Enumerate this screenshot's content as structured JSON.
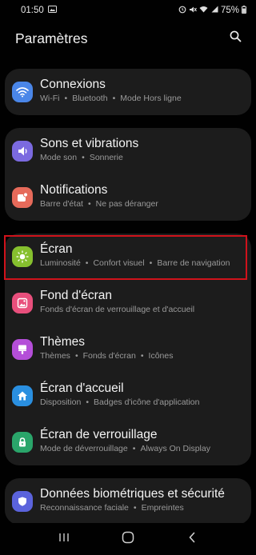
{
  "status_bar": {
    "time": "01:50",
    "battery": "75%",
    "icons": [
      "image-icon",
      "alarm-icon",
      "mute-icon",
      "wifi-icon",
      "signal-icon",
      "battery-icon"
    ]
  },
  "header": {
    "title": "Paramètres",
    "search_icon": "search-icon"
  },
  "groups": [
    {
      "items": [
        {
          "title": "Connexions",
          "subtitle": [
            "Wi-Fi",
            "Bluetooth",
            "Mode Hors ligne"
          ],
          "icon": "wifi-icon",
          "color": "#4a86e8"
        }
      ]
    },
    {
      "items": [
        {
          "title": "Sons et vibrations",
          "subtitle": [
            "Mode son",
            "Sonnerie"
          ],
          "icon": "volume-icon",
          "color": "#7b6ae0"
        },
        {
          "title": "Notifications",
          "subtitle": [
            "Barre d'état",
            "Ne pas déranger"
          ],
          "icon": "notification-icon",
          "color": "#e66a5a"
        }
      ]
    },
    {
      "items": [
        {
          "title": "Écran",
          "subtitle": [
            "Luminosité",
            "Confort visuel",
            "Barre de navigation"
          ],
          "icon": "brightness-icon",
          "color": "#86c02e",
          "highlighted": true
        },
        {
          "title": "Fond d'écran",
          "subtitle": [
            "Fonds d'écran de verrouillage et d'accueil"
          ],
          "icon": "wallpaper-icon",
          "color": "#e84f7c"
        },
        {
          "title": "Thèmes",
          "subtitle": [
            "Thèmes",
            "Fonds d'écran",
            "Icônes"
          ],
          "icon": "theme-brush-icon",
          "color": "#b44ed8"
        },
        {
          "title": "Écran d'accueil",
          "subtitle": [
            "Disposition",
            "Badges d'icône d'application"
          ],
          "icon": "home-icon",
          "color": "#2a8fe0"
        },
        {
          "title": "Écran de verrouillage",
          "subtitle": [
            "Mode de déverrouillage",
            "Always On Display"
          ],
          "icon": "lock-icon",
          "color": "#2aa56a"
        }
      ]
    },
    {
      "items": [
        {
          "title": "Données biométriques et sécurité",
          "subtitle": [
            "Reconnaissance faciale",
            "Empreintes"
          ],
          "icon": "shield-icon",
          "color": "#5b63dc"
        }
      ]
    }
  ],
  "nav_bar": {
    "buttons": [
      "recent-apps-icon",
      "home-button-icon",
      "back-icon"
    ]
  }
}
